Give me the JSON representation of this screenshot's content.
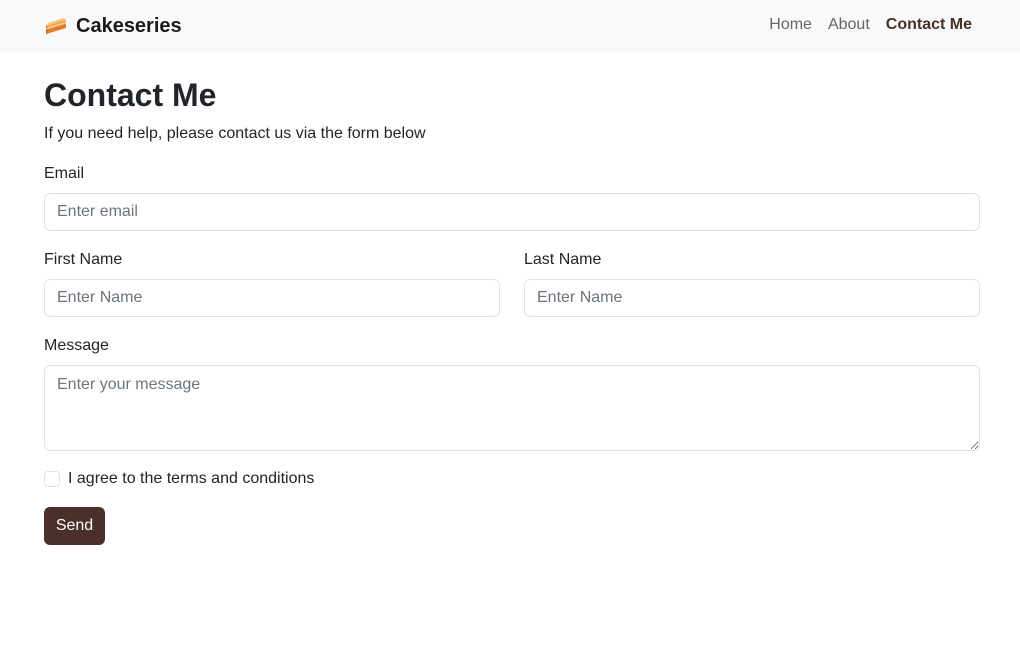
{
  "navbar": {
    "brand": "Cakeseries",
    "brand_icon": "cake-slice-icon",
    "links": [
      {
        "label": "Home",
        "active": false
      },
      {
        "label": "About",
        "active": false
      },
      {
        "label": "Contact Me",
        "active": true
      }
    ]
  },
  "page": {
    "title": "Contact Me",
    "subtitle": "If you need help, please contact us via the form below"
  },
  "form": {
    "email": {
      "label": "Email",
      "placeholder": "Enter email",
      "value": ""
    },
    "first_name": {
      "label": "First Name",
      "placeholder": "Enter Name",
      "value": ""
    },
    "last_name": {
      "label": "Last Name",
      "placeholder": "Enter Name",
      "value": ""
    },
    "message": {
      "label": "Message",
      "placeholder": "Enter your message",
      "value": ""
    },
    "terms": {
      "label": "I agree to the terms and conditions",
      "checked": false
    },
    "submit_label": "Send"
  },
  "colors": {
    "navbar_bg": "#f8f9fa",
    "accent": "#4a3028",
    "border": "#dee2e6",
    "text": "#212529",
    "muted": "#6c757d"
  }
}
